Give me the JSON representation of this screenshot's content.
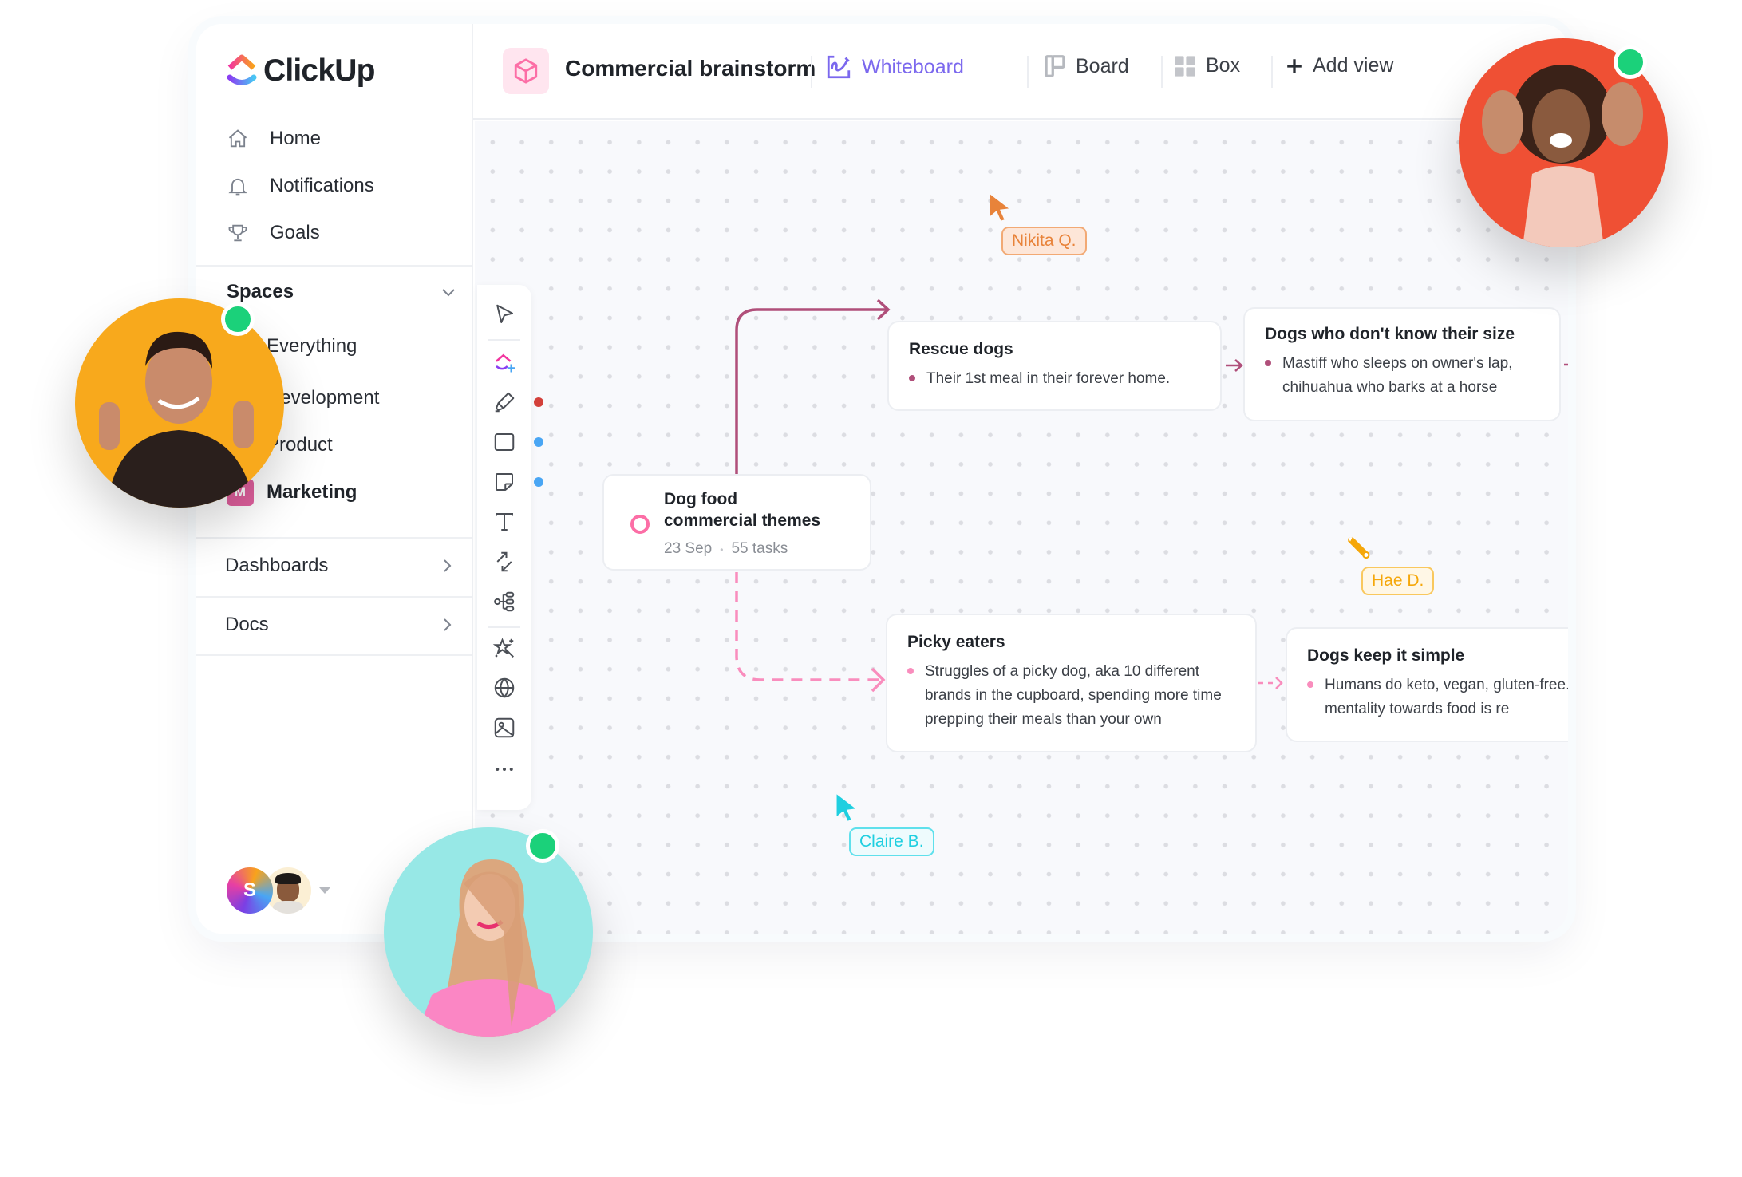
{
  "app": {
    "name": "ClickUp"
  },
  "sidebar": {
    "nav": [
      {
        "label": "Home",
        "icon": "home-icon"
      },
      {
        "label": "Notifications",
        "icon": "bell-icon"
      },
      {
        "label": "Goals",
        "icon": "trophy-icon"
      }
    ],
    "spaces_label": "Spaces",
    "spaces": [
      {
        "label": "Everything"
      },
      {
        "label": "Development"
      },
      {
        "label": "Product"
      },
      {
        "label": "Marketing",
        "badge": "M",
        "badge_color": "#e1609e",
        "active": true
      }
    ],
    "links": [
      {
        "label": "Dashboards"
      },
      {
        "label": "Docs"
      }
    ],
    "user": {
      "initial": "S"
    }
  },
  "header": {
    "project_title": "Commercial brainstorm",
    "tabs": [
      {
        "label": "Whiteboard",
        "icon": "whiteboard-icon",
        "active": true
      },
      {
        "label": "Board",
        "icon": "board-icon"
      },
      {
        "label": "Box",
        "icon": "box-grid-icon"
      },
      {
        "label": "Add view",
        "icon": "plus-icon"
      }
    ]
  },
  "toolbar": {
    "tools": [
      "select",
      "clickup-ai",
      "pen",
      "rectangle",
      "sticky-note",
      "text",
      "connector",
      "mind-map",
      "magic",
      "web-embed",
      "image",
      "more"
    ],
    "color_dots": {
      "pen": "#d3403a",
      "rectangle": "#49a6f4",
      "sticky-note": "#49a6f4"
    }
  },
  "whiteboard": {
    "main_card": {
      "title_line1": "Dog food",
      "title_line2": "commercial themes",
      "date": "23 Sep",
      "separator": "•",
      "tasks": "55 tasks"
    },
    "cards": [
      {
        "title": "Rescue dogs",
        "bullet": "Their 1st meal in their forever home."
      },
      {
        "title": "Dogs who don't know their size",
        "bullet": "Mastiff who sleeps on owner's lap, chihuahua who barks at a horse"
      },
      {
        "title": "Picky eaters",
        "bullet": "Struggles of a picky dog, aka 10 different brands in the cupboard, spending more time prepping their meals than your own"
      },
      {
        "title": "Dogs keep it simple",
        "bullet": "Humans do keto, vegan, gluten-free... dog mentality towards food is re"
      }
    ],
    "cursors": [
      {
        "name": "Nikita Q.",
        "color": "#e8833a",
        "bg": "#fde6d8"
      },
      {
        "name": "Hae D.",
        "color": "#f5a70a",
        "bg": "#fff7e6"
      },
      {
        "name": "Claire B.",
        "color": "#1fcfe0",
        "bg": "#eefbfd"
      }
    ]
  },
  "colors": {
    "accent": "#7b68ee",
    "solid_connector": "#b04f7a",
    "dashed_connector": "#f98dbd",
    "online": "#1bd17a"
  },
  "presence_avatars": [
    {
      "person": "man-thumbs-up",
      "bg": "#f8a91c",
      "online": true
    },
    {
      "person": "woman-hands-up",
      "bg": "#ef5034",
      "online": true
    },
    {
      "person": "woman-long-hair",
      "bg": "#97e8e6",
      "online": true
    }
  ]
}
